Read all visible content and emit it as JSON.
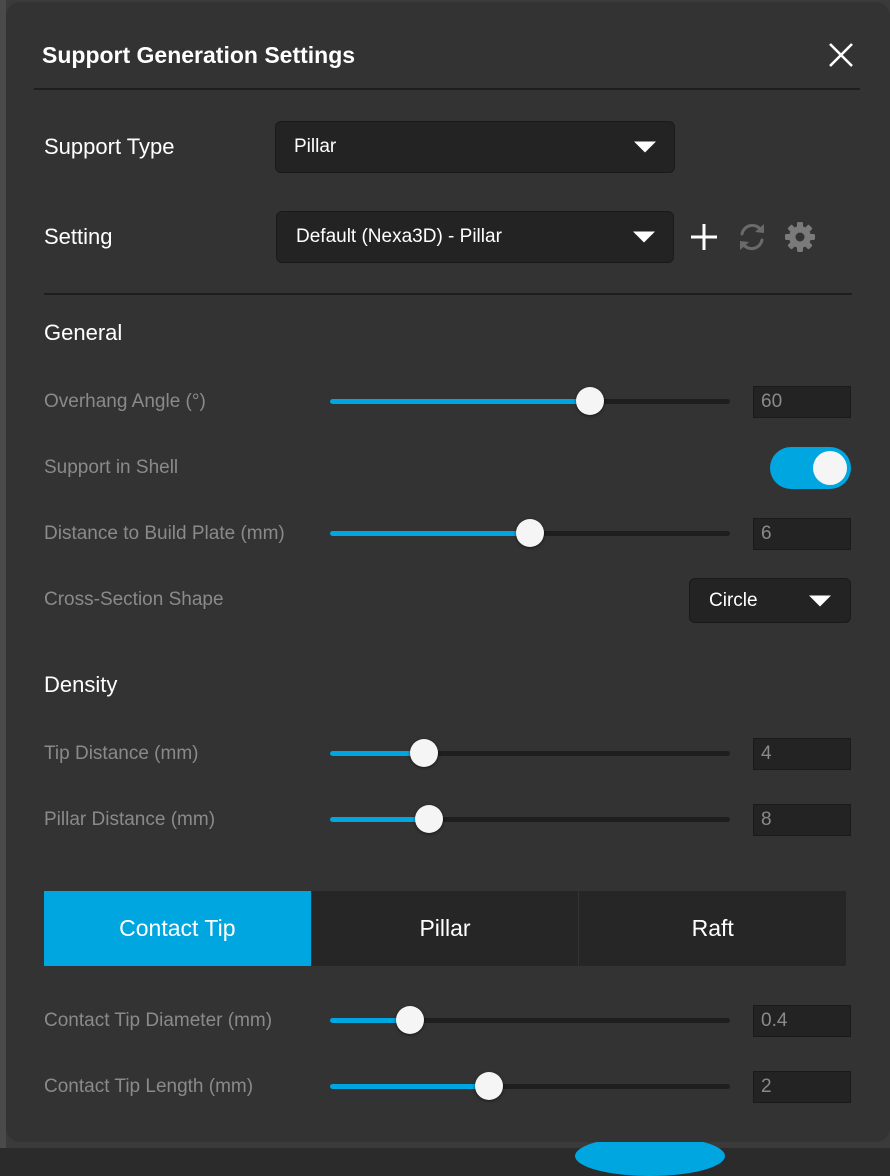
{
  "dialog": {
    "title": "Support Generation Settings"
  },
  "support_type": {
    "label": "Support Type",
    "value": "Pillar"
  },
  "setting": {
    "label": "Setting",
    "value": "Default (Nexa3D) - Pillar",
    "icons": [
      "plus-icon",
      "refresh-icon",
      "gear-icon"
    ]
  },
  "general": {
    "title": "General",
    "overhang_angle": {
      "label": "Overhang Angle (°)",
      "value": "60",
      "slider_fraction": 0.65
    },
    "support_in_shell": {
      "label": "Support in Shell",
      "enabled": true
    },
    "distance_to_build_plate": {
      "label": "Distance to Build Plate (mm)",
      "value": "6",
      "slider_fraction": 0.5
    },
    "cross_section_shape": {
      "label": "Cross-Section Shape",
      "value": "Circle"
    }
  },
  "density": {
    "title": "Density",
    "tip_distance": {
      "label": "Tip Distance (mm)",
      "value": "4",
      "slider_fraction": 0.235
    },
    "pillar_distance": {
      "label": "Pillar Distance (mm)",
      "value": "8",
      "slider_fraction": 0.247
    }
  },
  "tabs": [
    {
      "label": "Contact Tip",
      "active": true
    },
    {
      "label": "Pillar",
      "active": false
    },
    {
      "label": "Raft",
      "active": false
    }
  ],
  "contact_tip": {
    "diameter": {
      "label": "Contact Tip Diameter (mm)",
      "value": "0.4",
      "slider_fraction": 0.2
    },
    "length": {
      "label": "Contact Tip Length (mm)",
      "value": "2",
      "slider_fraction": 0.397
    }
  },
  "colors": {
    "accent": "#00a6e0",
    "panel": "#333333",
    "field": "#232323"
  }
}
